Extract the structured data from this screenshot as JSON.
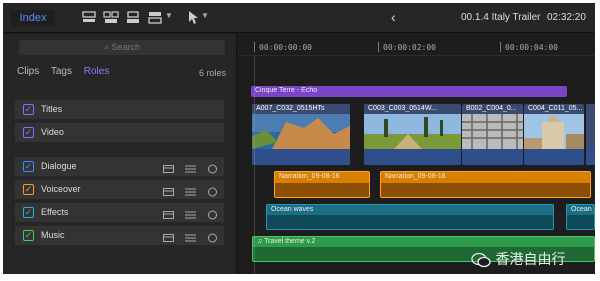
{
  "toolbar": {
    "index_label": "Index",
    "project_title": "00.1.4 Italy Trailer",
    "duration": "02:32:20",
    "icons": [
      "clip-appearance-icon",
      "clip-connect-icon",
      "clip-insert-icon",
      "clip-overwrite-icon",
      "select-tool-icon",
      "back-icon"
    ]
  },
  "sidebar": {
    "search_placeholder": "Search",
    "tabs": [
      {
        "label": "Clips",
        "active": false
      },
      {
        "label": "Tags",
        "active": false
      },
      {
        "label": "Roles",
        "active": true
      }
    ],
    "role_count": "6 roles",
    "roles": [
      {
        "label": "Titles",
        "checked": true,
        "color": "#8a6cff",
        "tools": false
      },
      {
        "label": "Video",
        "checked": true,
        "color": "#8a6cff",
        "tools": false
      },
      {
        "label": "Dialogue",
        "checked": true,
        "color": "#3e8bff",
        "tools": true
      },
      {
        "label": "Voiceover",
        "checked": true,
        "color": "#f0a030",
        "tools": true
      },
      {
        "label": "Effects",
        "checked": true,
        "color": "#2fb0d0",
        "tools": true
      },
      {
        "label": "Music",
        "checked": true,
        "color": "#3fcf60",
        "tools": true
      }
    ]
  },
  "timeline": {
    "timecodes": [
      "00:00:00:00",
      "00:00:02:00",
      "00:00:04:00"
    ],
    "connected_title": "Cinque Terre - Echo",
    "video_clips": [
      "A007_C032_0515HTs",
      "C003_C003_0514W...",
      "B002_C004_0...",
      "C004_C011_05..."
    ],
    "narration_clips": [
      "Narration_09-08-16",
      "Narration_09-08-16"
    ],
    "effects_clips": [
      "Ocean waves",
      "Ocean"
    ],
    "music_clip": "Travel theme v.2"
  },
  "watermark": {
    "text": "香港自由行"
  },
  "colors": {
    "accent": "#5a8cff",
    "roles_tab": "#8c7cff",
    "titles_bar": "#7a44c6",
    "voiceover": "#d97f00",
    "effects": "#1b6f84",
    "music": "#2e9b4a"
  }
}
